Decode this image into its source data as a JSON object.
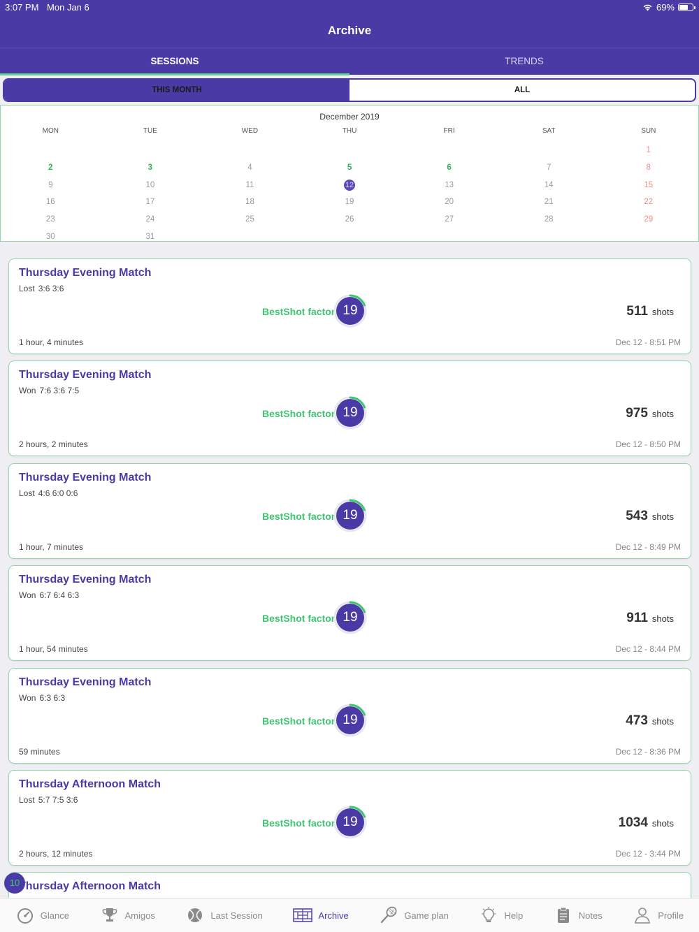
{
  "status": {
    "time": "3:07 PM",
    "date": "Mon Jan 6",
    "battery": "69%"
  },
  "header": {
    "title": "Archive"
  },
  "tabs": [
    {
      "label": "SESSIONS"
    },
    {
      "label": "TRENDS"
    }
  ],
  "segment": {
    "this_month": "THIS MONTH",
    "all": "ALL"
  },
  "calendar": {
    "month": "December 2019",
    "days": [
      "MON",
      "TUE",
      "WED",
      "THU",
      "FRI",
      "SAT",
      "SUN"
    ],
    "rows": [
      [
        "",
        "",
        "",
        "",
        "",
        "",
        "1"
      ],
      [
        "2",
        "3",
        "4",
        "5",
        "6",
        "7",
        "8"
      ],
      [
        "9",
        "10",
        "11",
        "12",
        "13",
        "14",
        "15"
      ],
      [
        "16",
        "17",
        "18",
        "19",
        "20",
        "21",
        "22"
      ],
      [
        "23",
        "24",
        "25",
        "26",
        "27",
        "28",
        "29"
      ],
      [
        "30",
        "31",
        "",
        "",
        "",
        "",
        ""
      ]
    ],
    "session_days": [
      "2",
      "3",
      "5",
      "6"
    ],
    "selected_day": "12"
  },
  "bsf_label": "BestShot factor",
  "shots_label": "shots",
  "sessions": [
    {
      "title": "Thursday Evening Match",
      "result": "Lost",
      "score": "3:6 3:6",
      "bsf": "19",
      "shots": "511",
      "duration": "1 hour, 4 minutes",
      "stamp": "Dec 12 - 8:51 PM"
    },
    {
      "title": "Thursday Evening Match",
      "result": "Won",
      "score": "7:6 3:6 7:5",
      "bsf": "19",
      "shots": "975",
      "duration": "2 hours, 2 minutes",
      "stamp": "Dec 12 - 8:50 PM"
    },
    {
      "title": "Thursday Evening Match",
      "result": "Lost",
      "score": "4:6 6:0 0:6",
      "bsf": "19",
      "shots": "543",
      "duration": "1 hour, 7 minutes",
      "stamp": "Dec 12 - 8:49 PM"
    },
    {
      "title": "Thursday Evening Match",
      "result": "Won",
      "score": "6:7 6:4 6:3",
      "bsf": "19",
      "shots": "911",
      "duration": "1 hour, 54 minutes",
      "stamp": "Dec 12 - 8:44 PM"
    },
    {
      "title": "Thursday Evening Match",
      "result": "Won",
      "score": "6:3 6:3",
      "bsf": "19",
      "shots": "473",
      "duration": "59 minutes",
      "stamp": "Dec 12 - 8:36 PM"
    },
    {
      "title": "Thursday Afternoon Match",
      "result": "Lost",
      "score": "5:7 7:5 3:6",
      "bsf": "19",
      "shots": "1034",
      "duration": "2 hours, 12 minutes",
      "stamp": "Dec 12 - 3:44 PM"
    },
    {
      "title": "Thursday Afternoon Match",
      "result": "",
      "score": "",
      "bsf": "",
      "shots": "",
      "duration": "",
      "stamp": ""
    }
  ],
  "badge_count": "10",
  "nav": [
    {
      "label": "Glance",
      "icon": "gauge-icon"
    },
    {
      "label": "Amigos",
      "icon": "trophy-icon"
    },
    {
      "label": "Last Session",
      "icon": "tennis-ball-icon"
    },
    {
      "label": "Archive",
      "icon": "court-icon"
    },
    {
      "label": "Game plan",
      "icon": "racket-icon"
    },
    {
      "label": "Help",
      "icon": "lightbulb-icon"
    },
    {
      "label": "Notes",
      "icon": "clipboard-icon"
    },
    {
      "label": "Profile",
      "icon": "person-icon"
    }
  ],
  "colors": {
    "primary": "#4a3aa5",
    "accent": "#3ec56f",
    "weekend": "#f08d86"
  }
}
